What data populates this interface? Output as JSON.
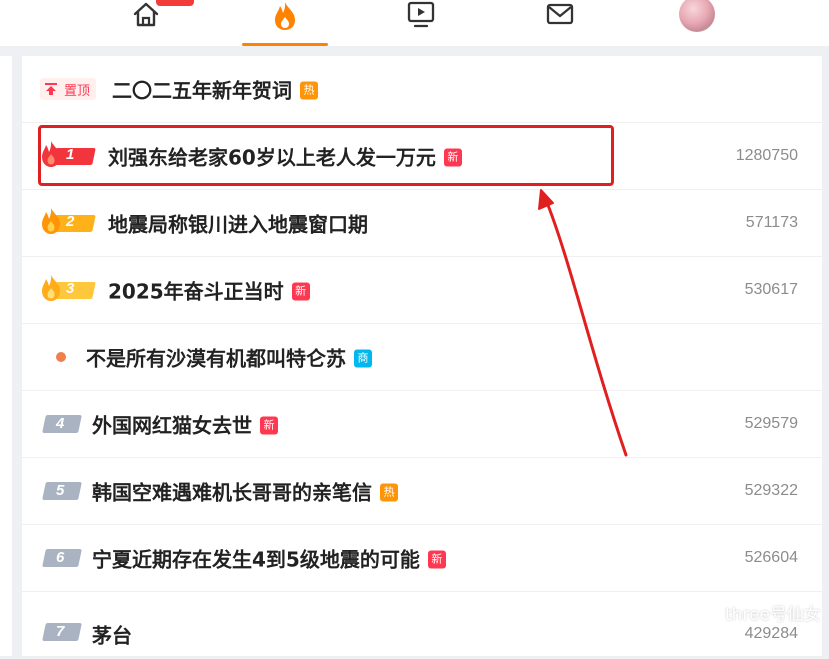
{
  "nav": {
    "items": [
      {
        "name": "home",
        "icon": "home-icon"
      },
      {
        "name": "hot",
        "icon": "flame-icon",
        "active": true
      },
      {
        "name": "video",
        "icon": "video-icon"
      },
      {
        "name": "messages",
        "icon": "mail-icon"
      },
      {
        "name": "profile",
        "icon": "avatar"
      }
    ],
    "accent": "#ff8200"
  },
  "pinned": {
    "badge": "置顶",
    "title": "二〇二五年新年贺词",
    "tag": "热"
  },
  "rows": [
    {
      "rank": "1",
      "title": "刘强东给老家60岁以上老人发一万元",
      "tag": "新",
      "count": "1280750"
    },
    {
      "rank": "2",
      "title": "地震局称银川进入地震窗口期",
      "tag": "",
      "count": "571173"
    },
    {
      "rank": "3",
      "title": "2025年奋斗正当时",
      "tag": "新",
      "count": "530617"
    },
    {
      "rank": "",
      "title": "不是所有沙漠有机都叫特仑苏",
      "tag": "商",
      "count": ""
    },
    {
      "rank": "4",
      "title": "外国网红猫女去世",
      "tag": "新",
      "count": "529579"
    },
    {
      "rank": "5",
      "title": "韩国空难遇难机长哥哥的亲笔信",
      "tag": "热",
      "count": "529322"
    },
    {
      "rank": "6",
      "title": "宁夏近期存在发生4到5级地震的可能",
      "tag": "新",
      "count": "526604"
    },
    {
      "rank": "7",
      "title": "茅台",
      "tag": "",
      "count": "429284"
    }
  ],
  "watermark": "three号仙女",
  "colors": {
    "new": "#ff3852",
    "hot": "#ff9406",
    "ad": "#00b7ee",
    "highlight": "#e02020"
  }
}
